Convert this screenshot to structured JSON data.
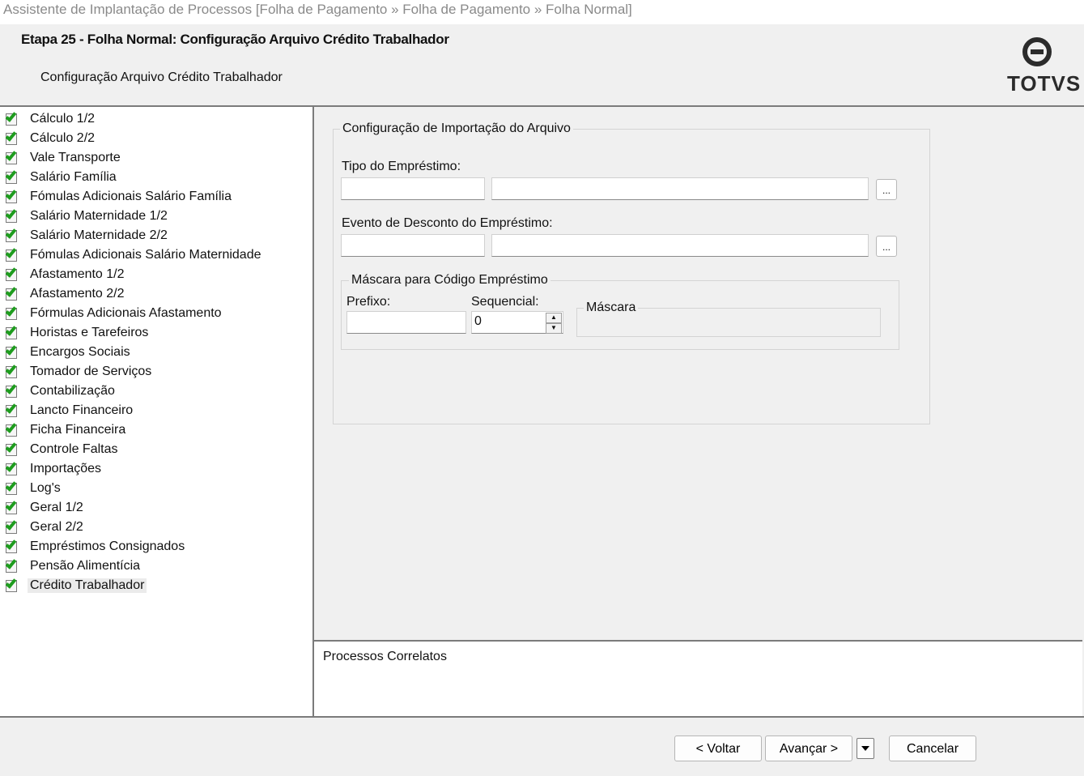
{
  "window": {
    "title": "Assistente de Implantação de Processos [Folha de Pagamento » Folha de Pagamento » Folha Normal]"
  },
  "header": {
    "step_title": "Etapa 25 - Folha Normal: Configuração Arquivo Crédito Trabalhador",
    "step_subtitle": "Configuração Arquivo Crédito Trabalhador",
    "logo_text": "TOTVS",
    "logo_icon": "totvs-logo-icon"
  },
  "steps": [
    {
      "label": "Cálculo 1/2",
      "icon": "completed-check-icon"
    },
    {
      "label": "Cálculo 2/2",
      "icon": "completed-check-icon"
    },
    {
      "label": "Vale Transporte",
      "icon": "completed-check-icon"
    },
    {
      "label": "Salário Família",
      "icon": "completed-check-icon"
    },
    {
      "label": "Fómulas Adicionais Salário Família",
      "icon": "completed-check-icon"
    },
    {
      "label": "Salário Maternidade 1/2",
      "icon": "completed-check-icon"
    },
    {
      "label": "Salário Maternidade 2/2",
      "icon": "completed-check-icon"
    },
    {
      "label": "Fómulas Adicionais Salário Maternidade",
      "icon": "completed-check-icon"
    },
    {
      "label": "Afastamento 1/2",
      "icon": "completed-check-icon"
    },
    {
      "label": "Afastamento 2/2",
      "icon": "completed-check-icon"
    },
    {
      "label": "Fórmulas Adicionais Afastamento",
      "icon": "completed-check-icon"
    },
    {
      "label": "Horistas e Tarefeiros",
      "icon": "completed-check-icon"
    },
    {
      "label": "Encargos Sociais",
      "icon": "completed-check-icon"
    },
    {
      "label": "Tomador de Serviços",
      "icon": "completed-check-icon"
    },
    {
      "label": "Contabilização",
      "icon": "completed-check-icon"
    },
    {
      "label": "Lancto Financeiro",
      "icon": "completed-check-icon"
    },
    {
      "label": "Ficha Financeira",
      "icon": "completed-check-icon"
    },
    {
      "label": "Controle Faltas",
      "icon": "completed-check-icon"
    },
    {
      "label": "Importações",
      "icon": "completed-check-icon"
    },
    {
      "label": "Log's",
      "icon": "completed-check-icon"
    },
    {
      "label": "Geral 1/2",
      "icon": "completed-check-icon"
    },
    {
      "label": "Geral 2/2",
      "icon": "completed-check-icon"
    },
    {
      "label": "Empréstimos Consignados",
      "icon": "completed-check-icon"
    },
    {
      "label": "Pensão Alimentícia",
      "icon": "completed-check-icon"
    },
    {
      "label": "Crédito Trabalhador",
      "icon": "completed-check-icon",
      "selected": true
    }
  ],
  "form": {
    "group_title": "Configuração de Importação do Arquivo",
    "tipo_emprestimo": {
      "label": "Tipo do Empréstimo:",
      "code_value": "",
      "description_value": "",
      "lookup_label": "..."
    },
    "evento_desconto": {
      "label": "Evento de Desconto do Empréstimo:",
      "code_value": "",
      "description_value": "",
      "lookup_label": "..."
    },
    "mascara_group": {
      "title": "Máscara para Código Empréstimo",
      "prefixo_label": "Prefixo:",
      "prefixo_value": "",
      "sequencial_label": "Sequencial:",
      "sequencial_value": "0",
      "mascara_title": "Máscara"
    }
  },
  "related": {
    "title": "Processos Correlatos"
  },
  "footer": {
    "back_label": "< Voltar",
    "next_label": "Avançar >",
    "cancel_label": "Cancelar"
  }
}
